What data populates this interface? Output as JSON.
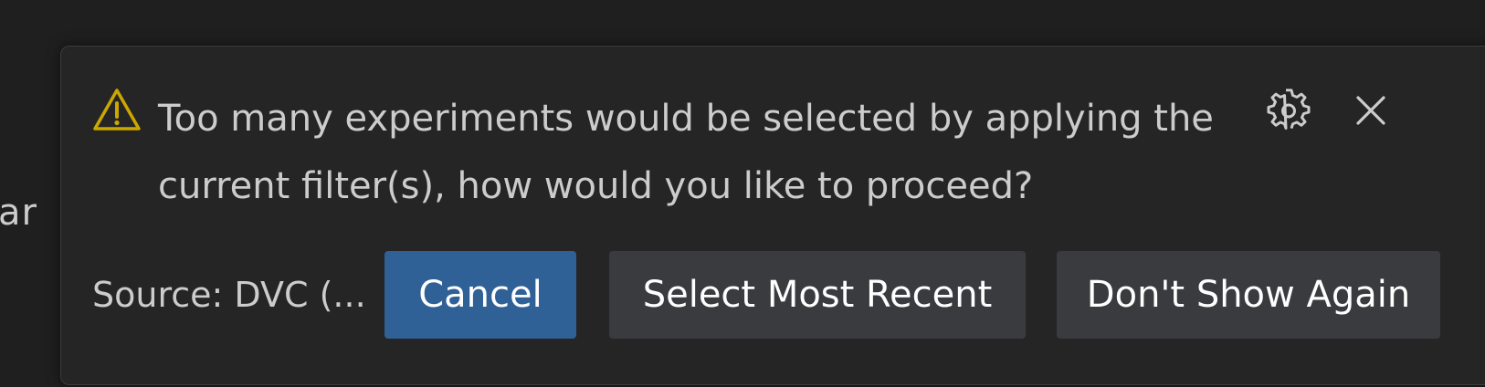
{
  "background": {
    "partial_text": "ar"
  },
  "notification": {
    "message": "Too many experiments would be selected by applying the current filter(s), how would you like to proceed?",
    "source": "Source: DVC (...",
    "icons": {
      "warning": "warning-icon",
      "settings": "gear-icon",
      "close": "close-icon"
    },
    "buttons": {
      "cancel": "Cancel",
      "select_most_recent": "Select Most Recent",
      "dont_show_again": "Don't Show Again"
    },
    "colors": {
      "warning": "#cca700",
      "primary_button": "#2f6197",
      "secondary_button": "#3a3b3e",
      "background": "#252526"
    }
  }
}
